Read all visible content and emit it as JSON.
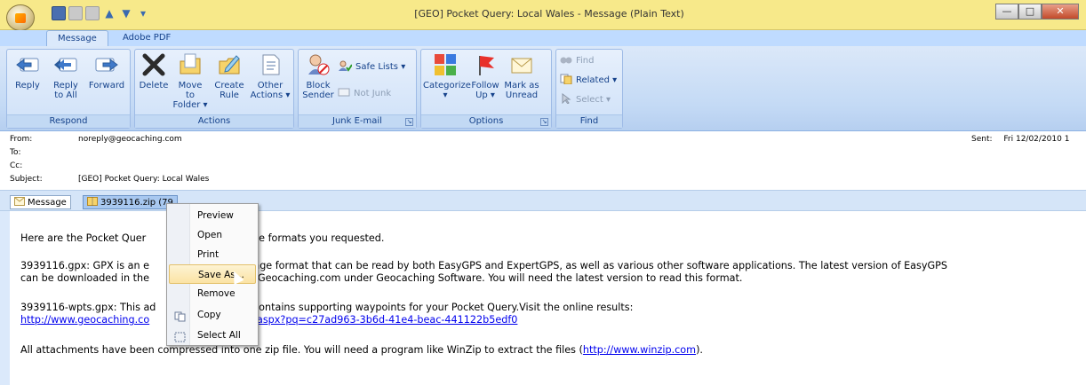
{
  "window": {
    "title": "[GEO] Pocket Query: Local Wales - Message (Plain Text)",
    "min": "—",
    "max": "□",
    "close": "✕"
  },
  "tabs": [
    {
      "label": "Message"
    },
    {
      "label": "Adobe PDF"
    }
  ],
  "ribbon": {
    "respond": {
      "label": "Respond",
      "reply": "Reply",
      "reply_all_1": "Reply",
      "reply_all_2": "to All",
      "forward": "Forward"
    },
    "actions": {
      "label": "Actions",
      "delete": "Delete",
      "move_1": "Move to",
      "move_2": "Folder ▾",
      "create_1": "Create",
      "create_2": "Rule",
      "other_1": "Other",
      "other_2": "Actions ▾"
    },
    "junk": {
      "label": "Junk E-mail",
      "block_1": "Block",
      "block_2": "Sender",
      "safe_lists": "Safe Lists ▾",
      "not_junk": "Not Junk"
    },
    "options": {
      "label": "Options",
      "categorize": "Categorize",
      "categorize_2": "▾",
      "follow_1": "Follow",
      "follow_2": "Up ▾",
      "mark_1": "Mark as",
      "mark_2": "Unread"
    },
    "find": {
      "label": "Find",
      "find": "Find",
      "related": "Related ▾",
      "select": "Select ▾"
    }
  },
  "header": {
    "from_label": "From:",
    "from": "noreply@geocaching.com",
    "to_label": "To:",
    "cc_label": "Cc:",
    "subject_label": "Subject:",
    "subject": "[GEO] Pocket Query: Local Wales",
    "sent_label": "Sent:",
    "sent": "Fri 12/02/2010 1"
  },
  "attachments": {
    "message": "Message",
    "zip": "3939116.zip (79"
  },
  "body": {
    "p1a": "Here are the Pocket Quer",
    "p1b": "n the formats you requested.",
    "p2a_1": "3939116.gpx: GPX is an e",
    "p2a_2": "change format that can be read by both EasyGPS and ExpertGPS, as well as various other software applications. The latest version of EasyGPS",
    "p2b_1": "can be downloaded in the",
    "p2b_2": "n of Geocaching.com under Geocaching Software. You will need the latest version to read this format.",
    "p3a_1": "3939116-wpts.gpx: This ad",
    "p3a_2": "contains supporting waypoints for your Pocket Query.Visit the online results:",
    "p3b_1": "http://www.geocaching.co",
    "p3b_2": "aspx?pq=c27ad963-3b6d-41e4-beac-441122b5edf0",
    "p4": "All attachments have been compressed into one zip file. You will need a program like WinZip to extract the files (",
    "p4_link": "http://www.winzip.com",
    "p4_end": ")."
  },
  "context_menu": [
    {
      "label": "Preview"
    },
    {
      "label": "Open"
    },
    {
      "label": "Print"
    },
    {
      "label": "Save As..."
    },
    {
      "label": "Remove"
    },
    {
      "label": "Copy"
    },
    {
      "label": "Select All"
    }
  ]
}
